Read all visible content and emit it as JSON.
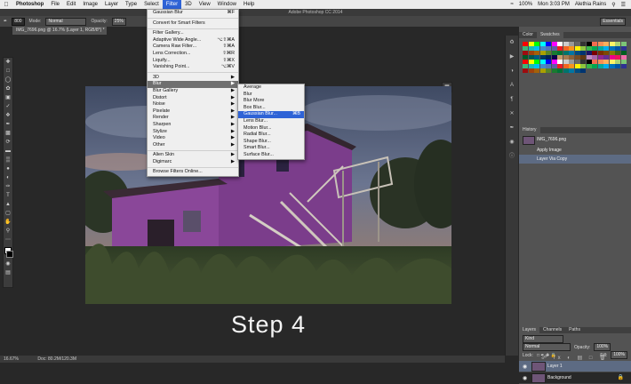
{
  "menubar": {
    "app": "Photoshop",
    "items": [
      "File",
      "Edit",
      "Image",
      "Layer",
      "Type",
      "Select",
      "Filter",
      "3D",
      "View",
      "Window",
      "Help"
    ],
    "active_index": 6,
    "title": "Adobe Photoshop CC 2014",
    "battery": "100%",
    "clock": "Mon 3:03 PM",
    "user": "Alethia Rains"
  },
  "options": {
    "size": "800",
    "mode_label": "Mode:",
    "mode_value": "Normal",
    "opacity_label": "Opacity:",
    "opacity_value": "25%",
    "workspace": "Essentials"
  },
  "document": {
    "tab": "IMG_7696.png @ 16.7% (Layer 1, RGB/8*) *",
    "zoom": "16.67%",
    "doc_info": "Doc: 80.2M/120.3M"
  },
  "filter_menu": [
    {
      "label": "Gaussian Blur",
      "shortcut": "⌘F"
    },
    {
      "sep": true
    },
    {
      "label": "Convert for Smart Filters"
    },
    {
      "sep": true
    },
    {
      "label": "Filter Gallery..."
    },
    {
      "label": "Adaptive Wide Angle...",
      "shortcut": "⌥⇧⌘A"
    },
    {
      "label": "Camera Raw Filter...",
      "shortcut": "⇧⌘A"
    },
    {
      "label": "Lens Correction...",
      "shortcut": "⇧⌘R"
    },
    {
      "label": "Liquify...",
      "shortcut": "⇧⌘X"
    },
    {
      "label": "Vanishing Point...",
      "shortcut": "⌥⌘V"
    },
    {
      "sep": true
    },
    {
      "label": "3D",
      "submenu": true
    },
    {
      "label": "Blur",
      "submenu": true,
      "highlight": true
    },
    {
      "label": "Blur Gallery",
      "submenu": true
    },
    {
      "label": "Distort",
      "submenu": true
    },
    {
      "label": "Noise",
      "submenu": true
    },
    {
      "label": "Pixelate",
      "submenu": true
    },
    {
      "label": "Render",
      "submenu": true
    },
    {
      "label": "Sharpen",
      "submenu": true
    },
    {
      "label": "Stylize",
      "submenu": true
    },
    {
      "label": "Video",
      "submenu": true
    },
    {
      "label": "Other",
      "submenu": true
    },
    {
      "sep": true
    },
    {
      "label": "Alien Skin",
      "submenu": true
    },
    {
      "label": "Digimarc",
      "submenu": true
    },
    {
      "sep": true
    },
    {
      "label": "Browse Filters Online..."
    }
  ],
  "blur_submenu": [
    {
      "label": "Average"
    },
    {
      "label": "Blur"
    },
    {
      "label": "Blur More"
    },
    {
      "label": "Box Blur..."
    },
    {
      "label": "Gaussian Blur...",
      "shortcut": "⌘B",
      "highlight": true
    },
    {
      "label": "Lens Blur..."
    },
    {
      "label": "Motion Blur..."
    },
    {
      "label": "Radial Blur..."
    },
    {
      "label": "Shape Blur..."
    },
    {
      "label": "Smart Blur..."
    },
    {
      "label": "Surface Blur..."
    }
  ],
  "caption": "Step 4",
  "color_panel": {
    "tabs": [
      "Color",
      "Swatches"
    ],
    "active": 1
  },
  "history_panel": {
    "title": "History",
    "snapshot": "IMG_7696.png",
    "states": [
      "Apply Image",
      "Layer Via Copy"
    ],
    "selected": 1
  },
  "layers_panel": {
    "tabs": [
      "Layers",
      "Channels",
      "Paths"
    ],
    "kind": "Kind",
    "blend": "Normal",
    "opacity_label": "Opacity:",
    "opacity": "100%",
    "lock_label": "Lock:",
    "fill_label": "Fill:",
    "fill": "100%",
    "layers": [
      "Layer 1",
      "Background"
    ],
    "selected": 0
  },
  "colors": {
    "menu_highlight": "#2f63d6",
    "panel_bg": "#535353",
    "selection": "#5d6b83"
  }
}
